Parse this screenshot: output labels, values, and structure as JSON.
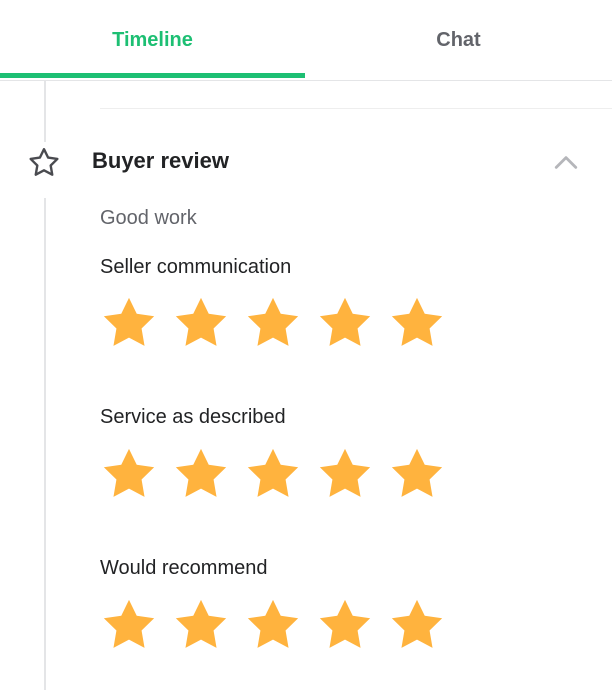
{
  "tabs": {
    "timeline_label": "Timeline",
    "chat_label": "Chat",
    "active": "Timeline"
  },
  "review": {
    "title": "Buyer review",
    "comment": "Good work",
    "ratings": [
      {
        "label": "Seller communication",
        "stars": 5,
        "max": 5
      },
      {
        "label": "Service as described",
        "stars": 5,
        "max": 5
      },
      {
        "label": "Would recommend",
        "stars": 5,
        "max": 5
      }
    ]
  },
  "colors": {
    "accent": "#1dbf73",
    "star": "#ffb33e",
    "text_primary": "#222325",
    "text_secondary": "#62646a",
    "divider": "#e4e5e7"
  },
  "icons": {
    "section": "star-outline-icon",
    "collapse": "chevron-up-icon",
    "rating": "star-icon"
  }
}
